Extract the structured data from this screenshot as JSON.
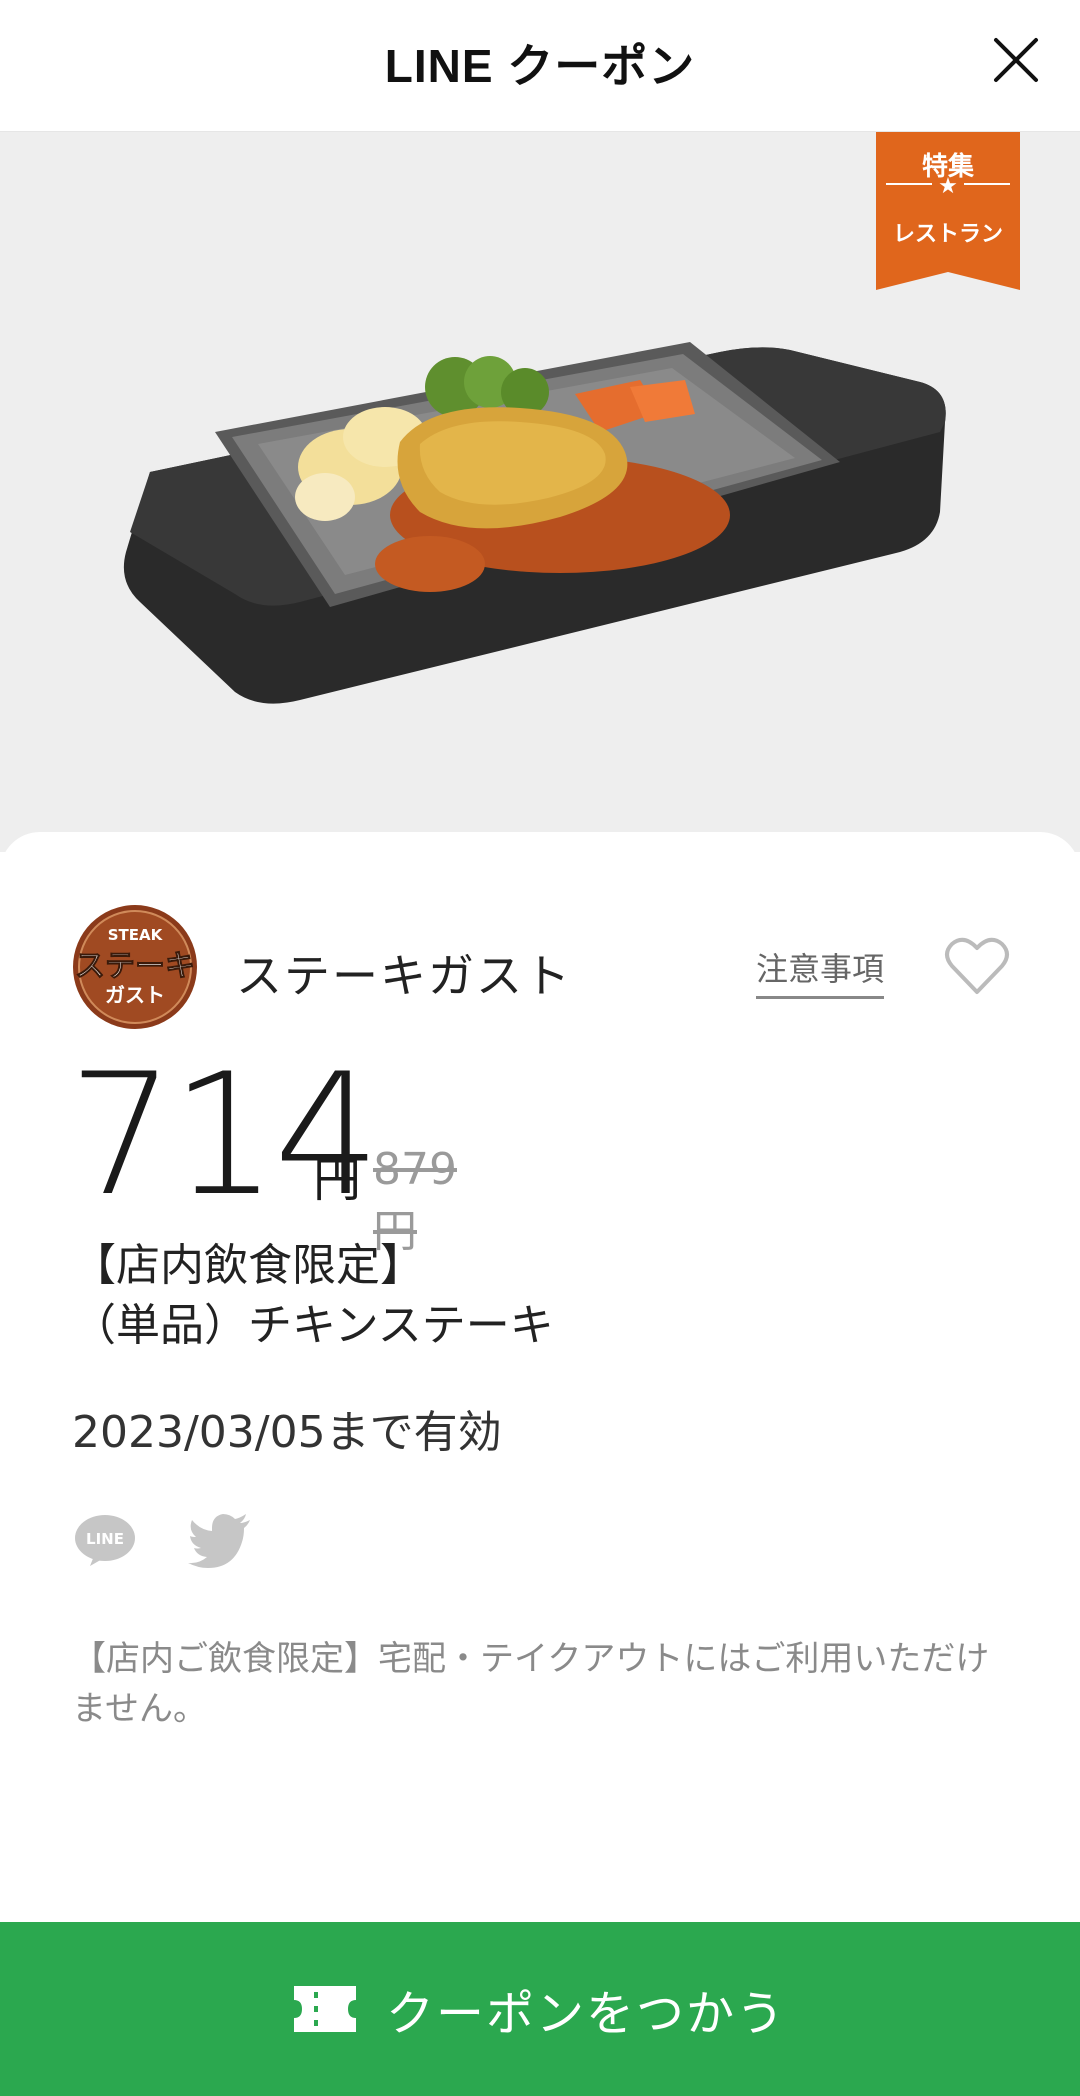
{
  "header": {
    "title": "LINE クーポン"
  },
  "ribbon": {
    "top": "特集",
    "bottom": "レストラン"
  },
  "store": {
    "logo_top": "STEAK",
    "logo_middle": "ステーキ",
    "logo_bottom": "ガスト",
    "name": "ステーキガスト",
    "notice_label": "注意事項"
  },
  "price": {
    "current": "714",
    "unit": "円",
    "original": "879円"
  },
  "coupon": {
    "title": "【店内飲食限定】\n（単品）チキンステーキ",
    "valid_until": "2023/03/05まで有効",
    "note": "【店内ご飲食限定】宅配・テイクアウトにはご利用いただけません。"
  },
  "share": {
    "line_label": "LINE"
  },
  "action": {
    "use_label": "クーポンをつかう"
  },
  "colors": {
    "accent_green": "#2ba84f",
    "ribbon_orange": "#e0661c",
    "logo_brown": "#8b3a1a"
  }
}
